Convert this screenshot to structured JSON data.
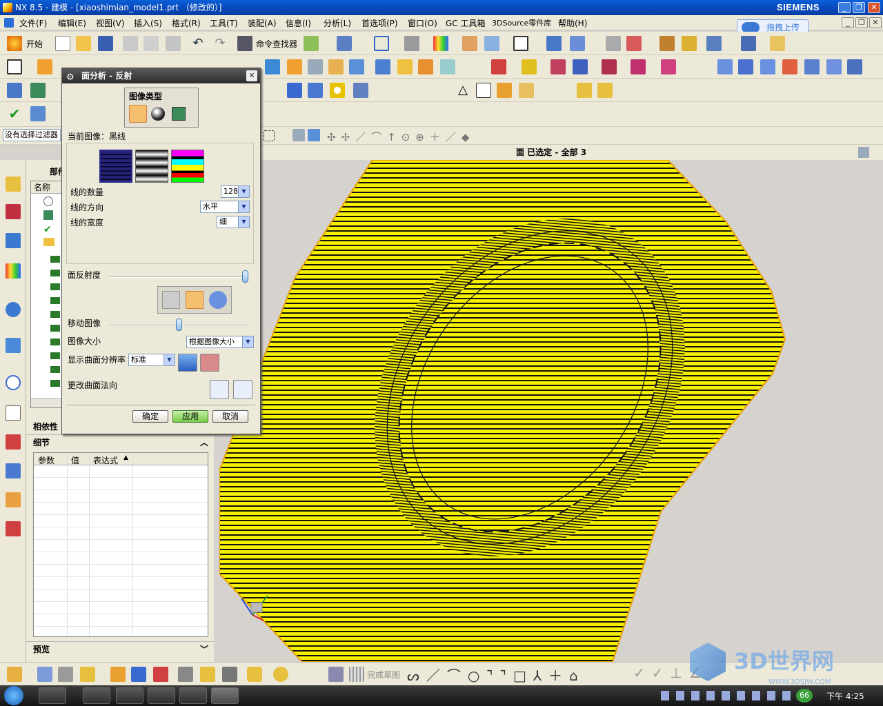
{
  "window": {
    "title": "NX 8.5 - 建模 - [xiaoshimian_model1.prt （修改的）]",
    "brand": "SIEMENS"
  },
  "menubar": [
    "文件(F)",
    "编辑(E)",
    "视图(V)",
    "插入(S)",
    "格式(R)",
    "工具(T)",
    "装配(A)",
    "信息(I)",
    "分析(L)",
    "首选项(P)",
    "窗口(O)",
    "GC 工具箱",
    "3DSource零件库",
    "帮助(H)"
  ],
  "upload_button": "拖拽上传",
  "toolbar": {
    "start_label": "开始",
    "command_finder": "命令查找器",
    "filter_value": "没有选择过滤器"
  },
  "status": {
    "selection": "面  已选定  -  全部  3"
  },
  "nav": {
    "header": "部件导航器",
    "name_col": "名称",
    "dependency_header": "相依性",
    "details_header": "细节",
    "details_cols": [
      "参数",
      "值",
      "表达式"
    ],
    "preview_header": "预览"
  },
  "dialog": {
    "title": "面分析  -  反射",
    "image_type_label": "图像类型",
    "current_image_label": "当前图像：黑线",
    "line_count_label": "线的数量",
    "line_count_value": "128",
    "line_direction_label": "线的方向",
    "line_direction_value": "水平",
    "line_width_label": "线的宽度",
    "line_width_value": "细",
    "reflectivity_label": "面反射度",
    "reflectivity_level": 1.0,
    "move_image_label": "移动图像",
    "move_image_level": 0.5,
    "image_size_label": "图像大小",
    "image_size_value": "根据图像大小",
    "resolution_label": "显示曲面分辨率",
    "resolution_value": "标准",
    "normal_label": "更改曲面法向",
    "ok": "确定",
    "apply": "应用",
    "cancel": "取消"
  },
  "bottom_toolbar": {
    "finish_sketch": "完成草图"
  },
  "taskbar": {
    "clock": "下午 4:25",
    "badge": "66"
  },
  "watermark": {
    "text": "3D世界网",
    "url": "WWW.3DSJW.COM"
  },
  "colors": {
    "surface_yellow": "#f6f000",
    "stripe_black": "#111111",
    "dialog_title": "#3a3a3a"
  }
}
